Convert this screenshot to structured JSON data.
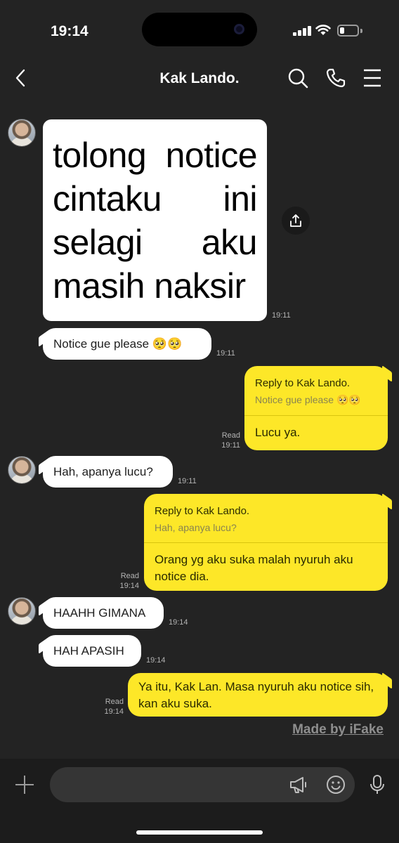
{
  "status_bar": {
    "time": "19:14",
    "battery_level": 0.25,
    "icons": [
      "signal-icon",
      "wifi-icon",
      "battery-icon"
    ]
  },
  "header": {
    "title": "Kak Lando.",
    "back_icon": "chevron-left-icon",
    "actions": [
      "search-icon",
      "phone-icon",
      "menu-icon"
    ]
  },
  "messages": {
    "image_text": [
      "tolong notice",
      "cintaku ini",
      "selagi aku",
      "masih naksir"
    ],
    "image_time": "19:11",
    "m1_text": "Notice gue please 🥺🥺",
    "m1_time": "19:11",
    "r1_reply_label": "Reply to Kak Lando.",
    "r1_reply_quote": "Notice gue please 🥺🥺",
    "r1_text": "Lucu ya.",
    "r1_read": "Read",
    "r1_time": "19:11",
    "m2_text": "Hah, apanya lucu?",
    "m2_time": "19:11",
    "r2_reply_label": "Reply to Kak Lando.",
    "r2_reply_quote": "Hah, apanya lucu?",
    "r2_text": "Orang yg aku suka malah nyuruh aku notice dia.",
    "r2_read": "Read",
    "r2_time": "19:14",
    "m3_text": "HAAHH GIMANA",
    "m3_time": "19:14",
    "m4_text": "HAH APASIH",
    "m4_time": "19:14",
    "r3_text": "Ya itu, Kak Lan. Masa nyuruh aku notice sih, kan aku suka.",
    "r3_read": "Read",
    "r3_time": "19:14"
  },
  "watermark": "Made by iFake",
  "input_bar": {
    "placeholder": "",
    "icons": [
      "plus-icon",
      "megaphone-icon",
      "emoji-icon",
      "microphone-icon"
    ]
  },
  "colors": {
    "background": "#232323",
    "incoming_bubble": "#ffffff",
    "outgoing_bubble": "#fde728"
  }
}
